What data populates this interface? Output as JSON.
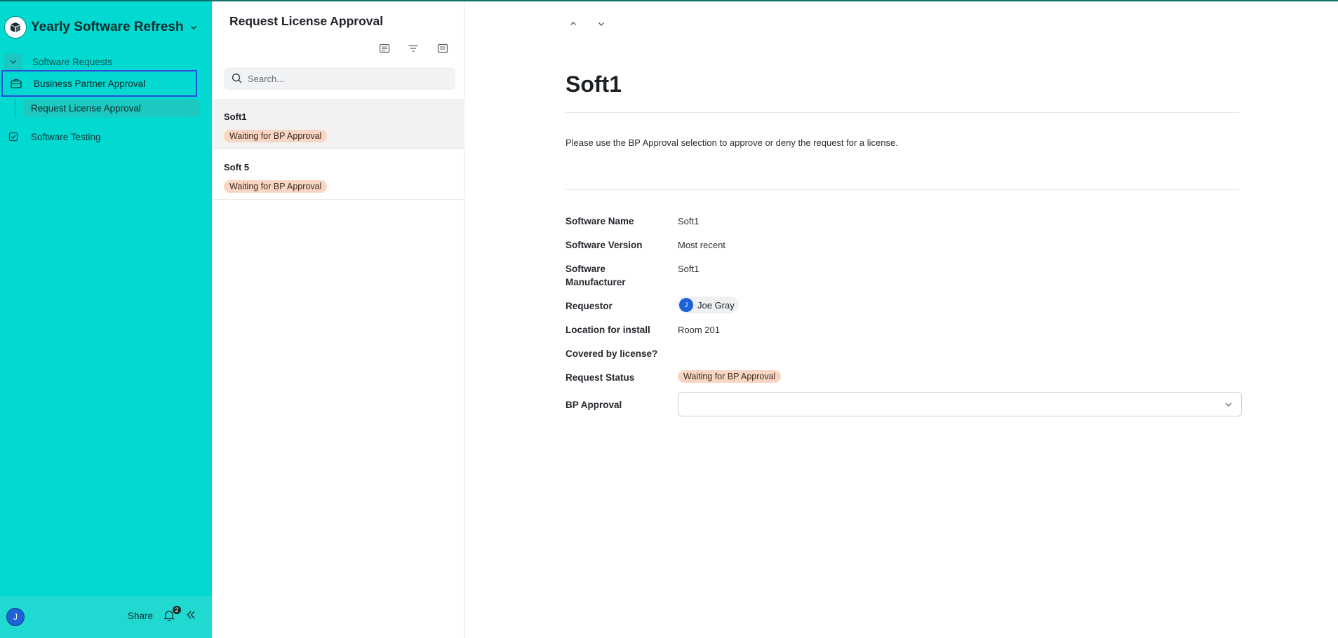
{
  "app": {
    "title": "Yearly Software Refresh"
  },
  "sidebar": {
    "group_label": "Software Requests",
    "items": [
      {
        "label": "Business Partner Approval",
        "icon": "briefcase-icon"
      },
      {
        "label": "Request License Approval",
        "icon": ""
      },
      {
        "label": "Software Testing",
        "icon": "checkbox-icon"
      }
    ],
    "footer": {
      "avatar_initial": "J",
      "share_label": "Share",
      "notification_count": "2"
    }
  },
  "list": {
    "title": "Request License Approval",
    "search_placeholder": "Search...",
    "records": [
      {
        "name": "Soft1",
        "status": "Waiting for BP Approval"
      },
      {
        "name": "Soft 5",
        "status": "Waiting for BP Approval"
      }
    ]
  },
  "detail": {
    "title": "Soft1",
    "description": "Please use the BP Approval selection to approve or deny the request for a license.",
    "fields": {
      "software_name": {
        "label": "Software Name",
        "value": "Soft1"
      },
      "software_version": {
        "label": "Software Version",
        "value": "Most recent"
      },
      "software_manufacturer": {
        "label": "Software Manufacturer",
        "value": "Soft1"
      },
      "requestor": {
        "label": "Requestor",
        "value": "Joe Gray",
        "initial": "J"
      },
      "location": {
        "label": "Location for install",
        "value": "Room 201"
      },
      "covered": {
        "label": "Covered by license?",
        "value": ""
      },
      "request_status": {
        "label": "Request Status",
        "value": "Waiting for BP Approval"
      },
      "bp_approval": {
        "label": "BP Approval",
        "value": ""
      }
    }
  },
  "colors": {
    "sidebar_bg": "#02d9d1",
    "selection_outline": "#2a4fd9",
    "status_pill": "#f9d6c3",
    "avatar": "#1b63d6"
  }
}
